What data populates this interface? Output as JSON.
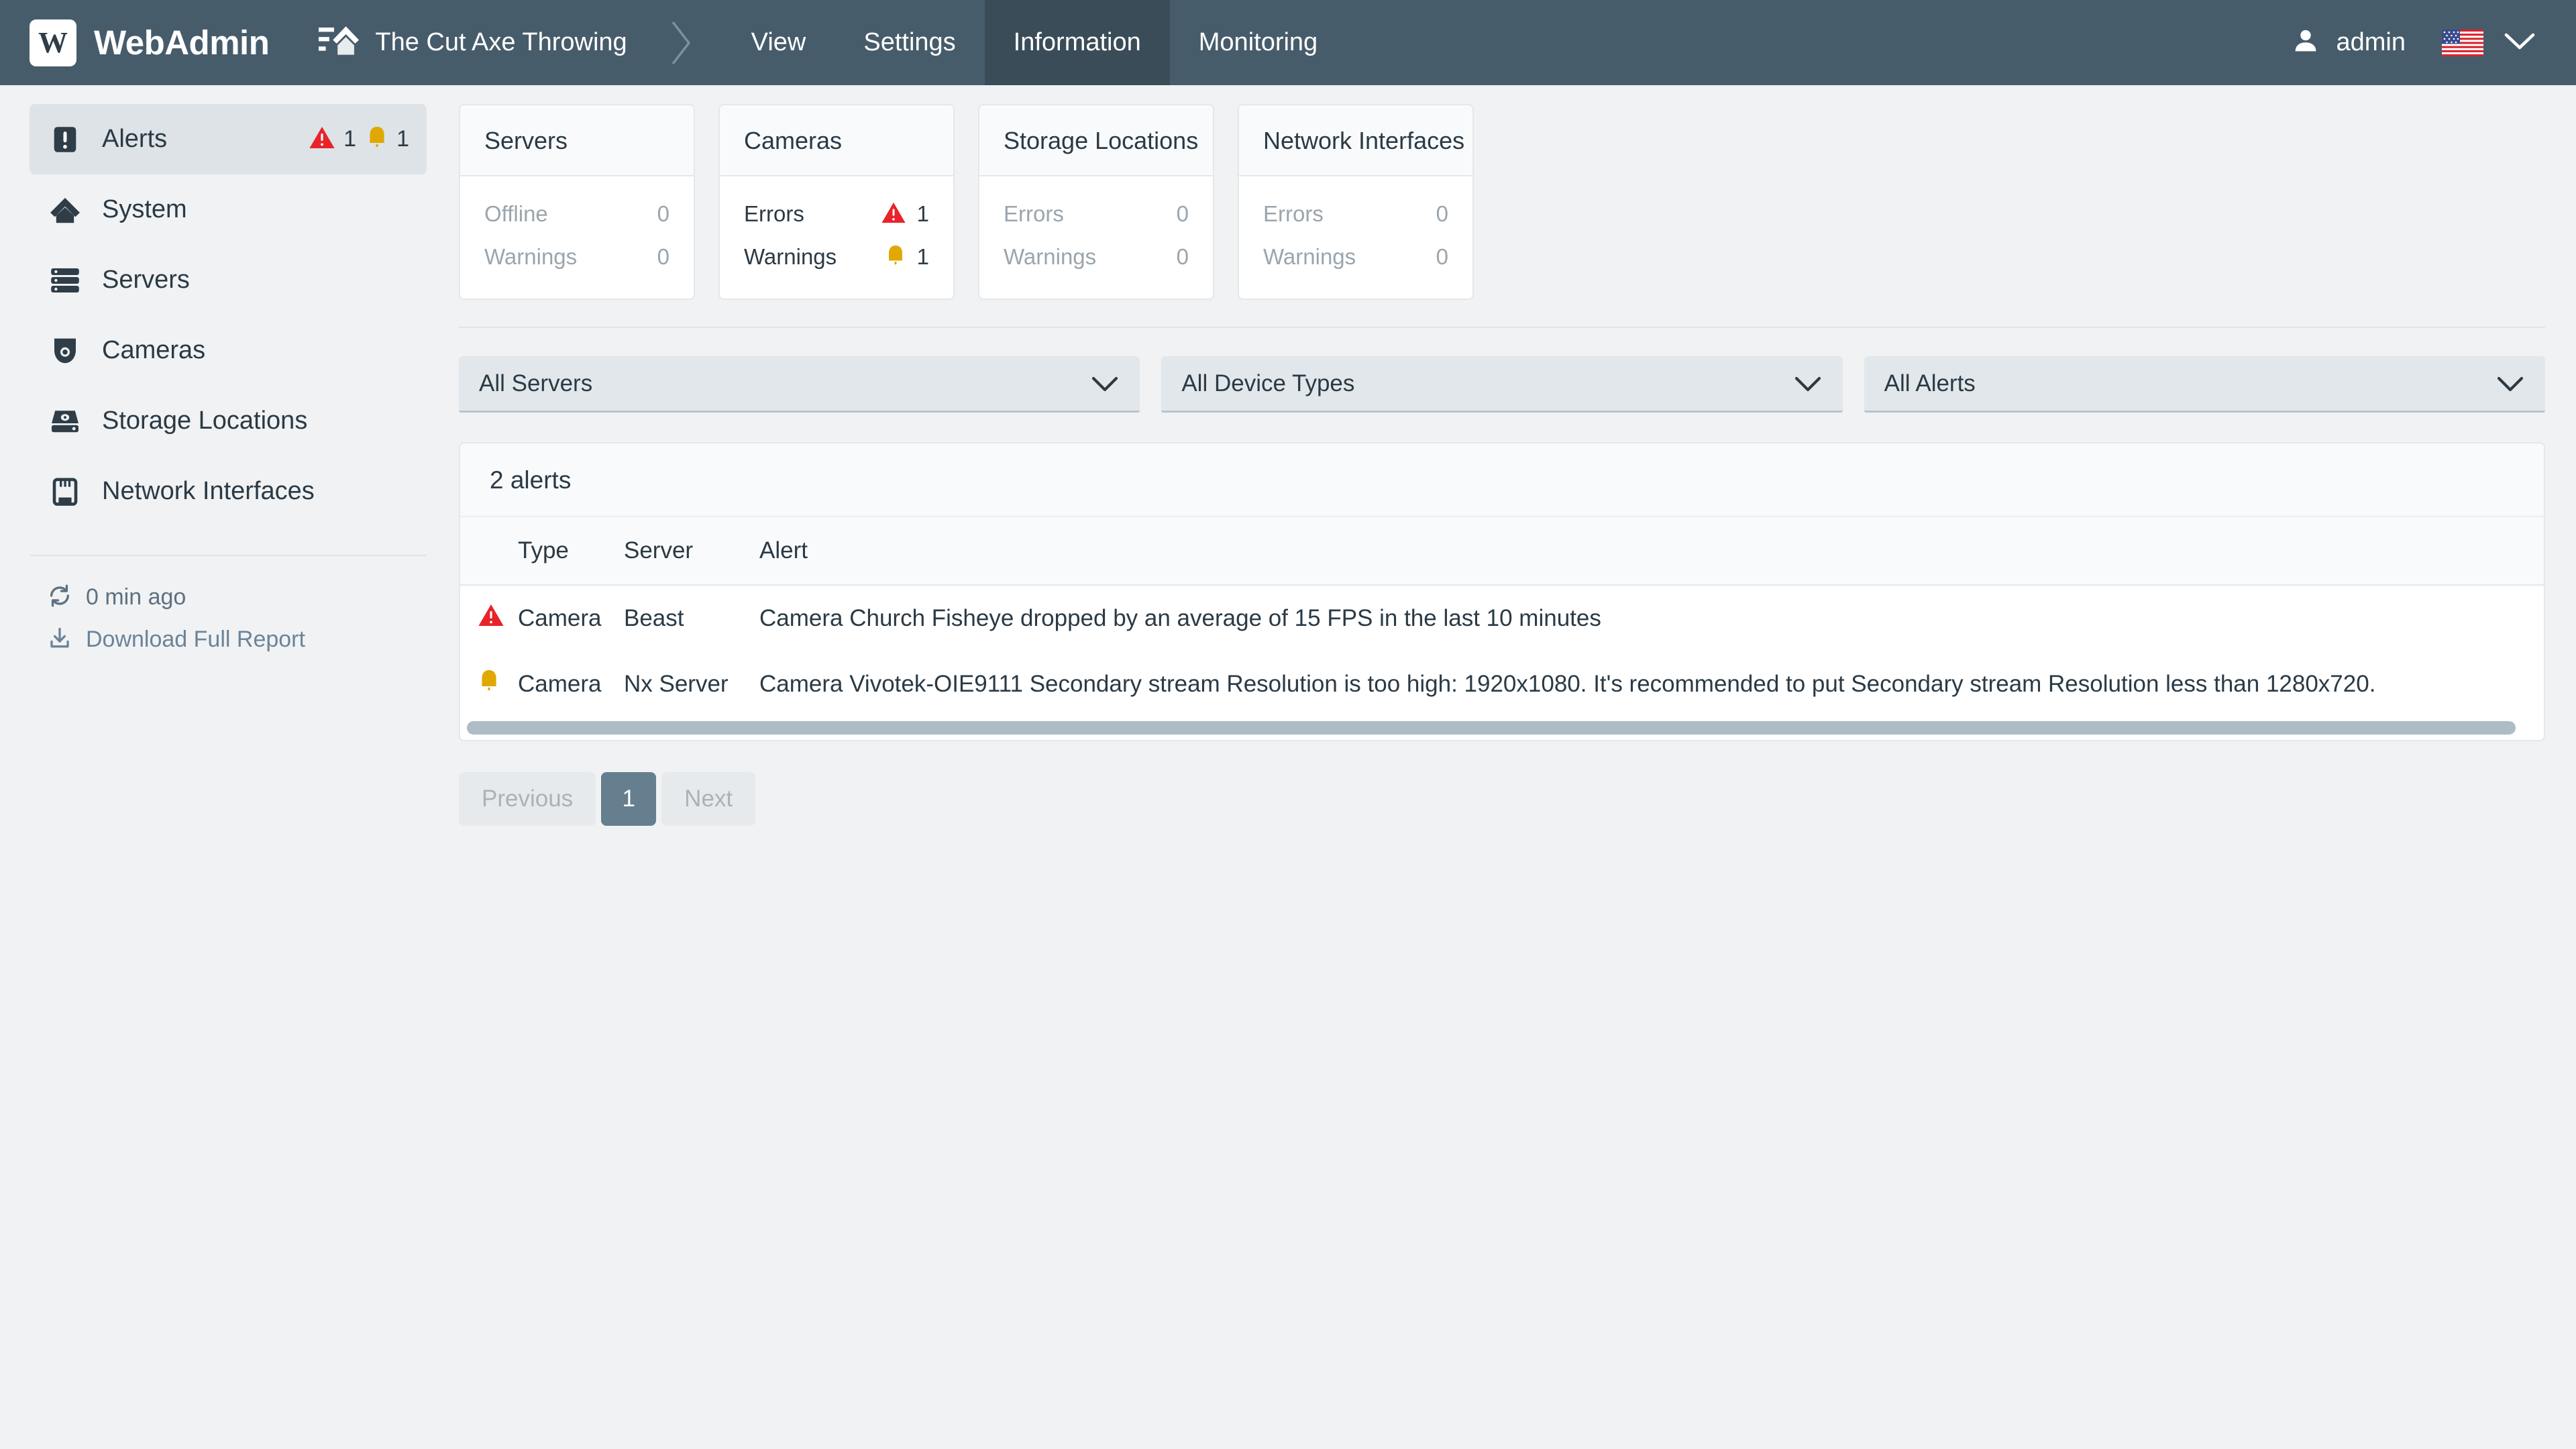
{
  "header": {
    "logo_letter": "W",
    "brand": "WebAdmin",
    "site_name": "The Cut Axe Throwing",
    "tabs": [
      {
        "label": "View",
        "active": false
      },
      {
        "label": "Settings",
        "active": false
      },
      {
        "label": "Information",
        "active": true
      },
      {
        "label": "Monitoring",
        "active": false
      }
    ],
    "user": "admin",
    "language_flag": "us-flag-icon"
  },
  "sidebar": {
    "items": [
      {
        "label": "Alerts",
        "icon": "alert-square-icon",
        "active": true,
        "errors": "1",
        "warnings": "1"
      },
      {
        "label": "System",
        "icon": "home-icon",
        "active": false
      },
      {
        "label": "Servers",
        "icon": "server-rack-icon",
        "active": false
      },
      {
        "label": "Cameras",
        "icon": "dome-camera-icon",
        "active": false
      },
      {
        "label": "Storage Locations",
        "icon": "hard-drive-icon",
        "active": false
      },
      {
        "label": "Network Interfaces",
        "icon": "ethernet-port-icon",
        "active": false
      }
    ],
    "refresh_label": "0 min ago",
    "download_label": "Download Full Report"
  },
  "cards": [
    {
      "title": "Servers",
      "rows": [
        {
          "label": "Offline",
          "value": "0",
          "icon": null,
          "muted": true
        },
        {
          "label": "Warnings",
          "value": "0",
          "icon": null,
          "muted": true
        }
      ]
    },
    {
      "title": "Cameras",
      "rows": [
        {
          "label": "Errors",
          "value": "1",
          "icon": "error-triangle-icon",
          "muted": false
        },
        {
          "label": "Warnings",
          "value": "1",
          "icon": "warning-bell-icon",
          "muted": false
        }
      ]
    },
    {
      "title": "Storage Locations",
      "rows": [
        {
          "label": "Errors",
          "value": "0",
          "icon": null,
          "muted": true
        },
        {
          "label": "Warnings",
          "value": "0",
          "icon": null,
          "muted": true
        }
      ]
    },
    {
      "title": "Network Interfaces",
      "rows": [
        {
          "label": "Errors",
          "value": "0",
          "icon": null,
          "muted": true
        },
        {
          "label": "Warnings",
          "value": "0",
          "icon": null,
          "muted": true
        }
      ]
    }
  ],
  "filters": [
    {
      "value": "All Servers",
      "name": "server-filter"
    },
    {
      "value": "All Device Types",
      "name": "device-type-filter"
    },
    {
      "value": "All Alerts",
      "name": "alert-filter"
    }
  ],
  "alerts_panel": {
    "count_label": "2 alerts",
    "columns": [
      "Type",
      "Server",
      "Alert"
    ],
    "rows": [
      {
        "severity": "error-triangle-icon",
        "type": "Camera",
        "server": "Beast",
        "alert": "Camera Church Fisheye dropped by an average of 15 FPS in the last 10 minutes"
      },
      {
        "severity": "warning-bell-icon",
        "type": "Camera",
        "server": "Nx Server",
        "alert": "Camera Vivotek-OIE9111 Secondary stream Resolution is too high: 1920x1080. It's recommended to put Secondary stream Resolution less than 1280x720."
      }
    ]
  },
  "pagination": {
    "previous": "Previous",
    "current": "1",
    "next": "Next"
  },
  "colors": {
    "header_bg": "#475c6b",
    "header_active": "#3a4c58",
    "error_red": "#e8232a",
    "warning_amber": "#e0a800",
    "accent_slate": "#657f8e",
    "page_bg": "#f0f2f4"
  }
}
